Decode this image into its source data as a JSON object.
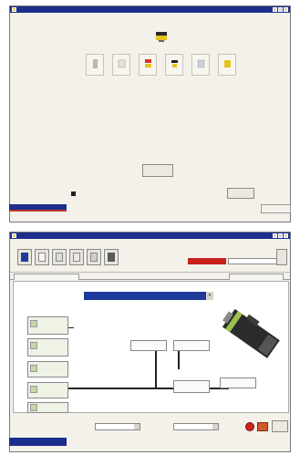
{
  "colors": {
    "title_bar": "#1c2f8c",
    "status_red": "#c7211c",
    "selection_blue": "#1e3a9c",
    "accent_yellow": "#e3c21e"
  },
  "top_window": {
    "title": "",
    "center_icon": "machine-icon",
    "icons": [
      {
        "name": "step-icon-1",
        "number": ""
      },
      {
        "name": "step-icon-2",
        "number": ""
      },
      {
        "name": "step-icon-3",
        "number": ""
      },
      {
        "name": "step-icon-4",
        "number": ""
      },
      {
        "name": "step-icon-5",
        "number": ""
      },
      {
        "name": "step-icon-6",
        "number": ""
      }
    ],
    "paragraph_1": "",
    "paragraph_2": "",
    "paragraph_3": "",
    "paragraph_4": "",
    "primary_button": "",
    "checkbox_label": "",
    "secondary_button": ""
  },
  "taskbar_top": {
    "left_label": "",
    "right_label": ""
  },
  "bottom_window": {
    "title": "",
    "menu": [
      "",
      "",
      "",
      "",
      "",
      ""
    ],
    "status_label": "",
    "status_value": "",
    "status_field": "",
    "tabs": [
      "",
      ""
    ],
    "machine_type_label": "",
    "machine_type_value": "",
    "left_labels": [
      "",
      "",
      "",
      "",
      ""
    ],
    "left_nodes": [
      "",
      "",
      "",
      "",
      ""
    ],
    "center_nodes": [
      "",
      "",
      ""
    ],
    "motor_label": "",
    "bottom_fields": [
      {
        "label": "",
        "value": ""
      },
      {
        "label": "",
        "value": ""
      }
    ],
    "bottom_button": ""
  },
  "taskbar_bottom": {
    "left_label": ""
  }
}
